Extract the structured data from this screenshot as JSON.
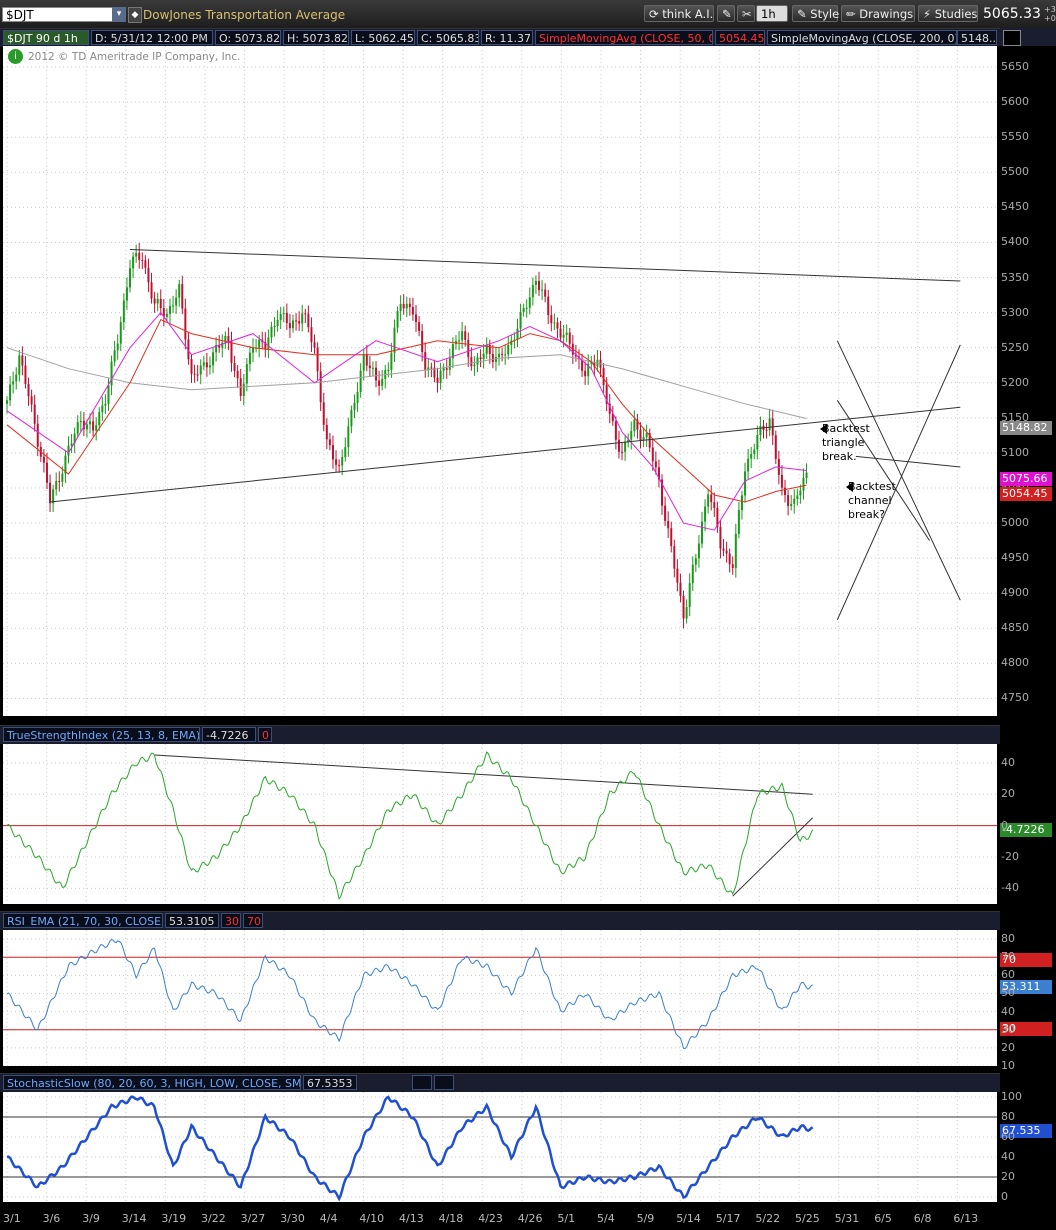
{
  "toolbar": {
    "symbol": "$DJT",
    "description": "DowJones Transportation Average",
    "think_ai": "think A.I.",
    "interval": "1h",
    "style": "Style",
    "drawings": "Drawings",
    "studies": "Studies",
    "last_price": "5065.33",
    "up_down": [
      "+3",
      "+0"
    ]
  },
  "infobar": {
    "symbol_period": "$DJT 90 d 1h",
    "date": "D: 5/31/12 12:00 PM",
    "open": "O: 5073.82",
    "high": "H: 5073.82",
    "low": "L: 5062.45",
    "close": "C: 5065.83",
    "range": "R: 11.37",
    "sma50_label": "SimpleMovingAvg (CLOSE, 50, 0)",
    "sma50_value": "5054.45",
    "sma200_label": "SimpleMovingAvg (CLOSE, 200, 0)",
    "sma200_value": "5148...",
    "copyright": "2012 © TD Ameritrade IP Company, Inc."
  },
  "annotations": {
    "triangle": "Backtest\ntriangle\nbreak.",
    "channel": "Backtest\nchannel\nbreak?"
  },
  "price_tags": {
    "sma200": "5148.82",
    "last": "5075.66",
    "sma50": "5054.45"
  },
  "studies": {
    "tsi_label": "TrueStrengthIndex (25, 13, 8, EMA)",
    "tsi_value": "-4.7226",
    "tsi_zero": "0",
    "tsi_tag": "-4.7226",
    "rsi_label": "RSI_EMA (21, 70, 30, CLOSE)",
    "rsi_value": "53.3105",
    "rsi_os": "30",
    "rsi_ob": "70",
    "rsi_tag": "53.311",
    "rsi_tag_70": "70",
    "rsi_tag_30": "30",
    "stoch_label": "StochasticSlow (80, 20, 60, 3, HIGH, LOW, CLOSE, SMA)",
    "stoch_value": "67.5353",
    "stoch_tag": "67.535"
  },
  "colors": {
    "sma50": "#e03020",
    "sma20": "#e020e0",
    "sma200": "#a0a0a0",
    "up_candle": "#1a9a1a",
    "down_candle": "#c01030",
    "tsi": "#28a828",
    "rsi": "#3a7fd0",
    "stoch": "#2050d0"
  },
  "chart_data": [
    {
      "type": "candlestick",
      "name": "price",
      "x_ticks": [
        "3/1",
        "3/6",
        "3/9",
        "3/14",
        "3/19",
        "3/22",
        "3/27",
        "3/30",
        "4/4",
        "4/10",
        "4/13",
        "4/18",
        "4/23",
        "4/26",
        "5/1",
        "5/4",
        "5/9",
        "5/14",
        "5/17",
        "5/22",
        "5/25",
        "5/31",
        "6/5",
        "6/8",
        "6/13"
      ],
      "y_ticks": [
        4750,
        4800,
        4850,
        4900,
        4950,
        5000,
        5050,
        5100,
        5150,
        5200,
        5250,
        5300,
        5350,
        5400,
        5450,
        5500,
        5550,
        5600,
        5650
      ],
      "ylim": [
        4725,
        5680
      ],
      "close_path": [
        [
          0,
          5170
        ],
        [
          4,
          5240
        ],
        [
          8,
          5160
        ],
        [
          12,
          5080
        ],
        [
          14,
          5030
        ],
        [
          18,
          5080
        ],
        [
          24,
          5150
        ],
        [
          28,
          5130
        ],
        [
          32,
          5180
        ],
        [
          36,
          5260
        ],
        [
          40,
          5370
        ],
        [
          44,
          5380
        ],
        [
          48,
          5310
        ],
        [
          52,
          5300
        ],
        [
          56,
          5330
        ],
        [
          60,
          5210
        ],
        [
          64,
          5220
        ],
        [
          68,
          5250
        ],
        [
          72,
          5260
        ],
        [
          76,
          5180
        ],
        [
          80,
          5260
        ],
        [
          84,
          5250
        ],
        [
          88,
          5300
        ],
        [
          92,
          5280
        ],
        [
          96,
          5300
        ],
        [
          100,
          5250
        ],
        [
          104,
          5110
        ],
        [
          108,
          5080
        ],
        [
          112,
          5150
        ],
        [
          116,
          5240
        ],
        [
          120,
          5200
        ],
        [
          124,
          5220
        ],
        [
          128,
          5320
        ],
        [
          132,
          5300
        ],
        [
          136,
          5230
        ],
        [
          140,
          5200
        ],
        [
          144,
          5240
        ],
        [
          148,
          5270
        ],
        [
          152,
          5220
        ],
        [
          156,
          5250
        ],
        [
          160,
          5230
        ],
        [
          164,
          5260
        ],
        [
          168,
          5300
        ],
        [
          172,
          5350
        ],
        [
          176,
          5300
        ],
        [
          180,
          5270
        ],
        [
          184,
          5250
        ],
        [
          188,
          5210
        ],
        [
          192,
          5240
        ],
        [
          196,
          5150
        ],
        [
          200,
          5100
        ],
        [
          204,
          5140
        ],
        [
          208,
          5120
        ],
        [
          212,
          5060
        ],
        [
          216,
          4960
        ],
        [
          220,
          4870
        ],
        [
          224,
          4950
        ],
        [
          228,
          5050
        ],
        [
          232,
          4970
        ],
        [
          236,
          4940
        ],
        [
          240,
          5080
        ],
        [
          244,
          5120
        ],
        [
          248,
          5150
        ],
        [
          252,
          5040
        ],
        [
          256,
          5030
        ],
        [
          260,
          5066
        ]
      ],
      "sma50_path": [
        [
          0,
          5140
        ],
        [
          20,
          5070
        ],
        [
          40,
          5200
        ],
        [
          50,
          5290
        ],
        [
          60,
          5270
        ],
        [
          80,
          5250
        ],
        [
          100,
          5240
        ],
        [
          120,
          5240
        ],
        [
          140,
          5260
        ],
        [
          160,
          5250
        ],
        [
          170,
          5270
        ],
        [
          180,
          5260
        ],
        [
          190,
          5230
        ],
        [
          200,
          5170
        ],
        [
          210,
          5120
        ],
        [
          220,
          5080
        ],
        [
          230,
          5040
        ],
        [
          240,
          5030
        ],
        [
          250,
          5045
        ],
        [
          260,
          5054
        ]
      ],
      "sma20_path": [
        [
          0,
          5160
        ],
        [
          20,
          5100
        ],
        [
          40,
          5250
        ],
        [
          50,
          5300
        ],
        [
          60,
          5240
        ],
        [
          80,
          5270
        ],
        [
          100,
          5200
        ],
        [
          120,
          5260
        ],
        [
          140,
          5230
        ],
        [
          160,
          5260
        ],
        [
          170,
          5280
        ],
        [
          180,
          5260
        ],
        [
          190,
          5220
        ],
        [
          200,
          5130
        ],
        [
          210,
          5080
        ],
        [
          220,
          5000
        ],
        [
          230,
          4990
        ],
        [
          240,
          5060
        ],
        [
          250,
          5080
        ],
        [
          260,
          5075
        ]
      ],
      "sma200_path": [
        [
          0,
          5250
        ],
        [
          20,
          5220
        ],
        [
          40,
          5200
        ],
        [
          60,
          5190
        ],
        [
          80,
          5195
        ],
        [
          100,
          5200
        ],
        [
          120,
          5210
        ],
        [
          140,
          5220
        ],
        [
          160,
          5235
        ],
        [
          180,
          5240
        ],
        [
          200,
          5220
        ],
        [
          220,
          5195
        ],
        [
          240,
          5170
        ],
        [
          260,
          5149
        ]
      ],
      "trendlines": [
        {
          "from": [
            14,
            5030
          ],
          "to": [
            310,
            5165
          ]
        },
        {
          "from": [
            40,
            5390
          ],
          "to": [
            310,
            5345
          ]
        },
        {
          "from": [
            270,
            4862
          ],
          "to": [
            310,
            5254
          ]
        },
        {
          "from": [
            270,
            5260
          ],
          "to": [
            310,
            4890
          ]
        },
        {
          "from": [
            270,
            5175
          ],
          "to": [
            300,
            4975
          ]
        },
        {
          "from": [
            276,
            5095
          ],
          "to": [
            310,
            5080
          ]
        }
      ]
    },
    {
      "type": "line",
      "name": "TrueStrengthIndex",
      "ylim": [
        -50,
        52
      ],
      "y_ticks": [
        -40,
        -20,
        0,
        20,
        40
      ],
      "zero_line": 0,
      "values": [
        [
          0,
          0
        ],
        [
          10,
          -20
        ],
        [
          18,
          -40
        ],
        [
          26,
          -10
        ],
        [
          34,
          20
        ],
        [
          42,
          40
        ],
        [
          48,
          45
        ],
        [
          54,
          10
        ],
        [
          60,
          -30
        ],
        [
          68,
          -20
        ],
        [
          76,
          0
        ],
        [
          84,
          30
        ],
        [
          92,
          20
        ],
        [
          100,
          0
        ],
        [
          108,
          -45
        ],
        [
          116,
          -20
        ],
        [
          124,
          10
        ],
        [
          132,
          20
        ],
        [
          140,
          0
        ],
        [
          148,
          20
        ],
        [
          156,
          45
        ],
        [
          164,
          30
        ],
        [
          172,
          0
        ],
        [
          180,
          -30
        ],
        [
          188,
          -20
        ],
        [
          196,
          20
        ],
        [
          204,
          35
        ],
        [
          212,
          0
        ],
        [
          220,
          -30
        ],
        [
          228,
          -25
        ],
        [
          236,
          -45
        ],
        [
          244,
          20
        ],
        [
          252,
          25
        ],
        [
          258,
          -10
        ],
        [
          262,
          -4.72
        ]
      ],
      "trendlines": [
        {
          "from": [
            48,
            45
          ],
          "to": [
            262,
            20
          ]
        },
        {
          "from": [
            236,
            -45
          ],
          "to": [
            262,
            5
          ]
        }
      ]
    },
    {
      "type": "line",
      "name": "RSI_EMA",
      "ylim": [
        10,
        85
      ],
      "y_ticks": [
        10,
        20,
        30,
        40,
        50,
        60,
        70,
        80
      ],
      "overbought": 70,
      "oversold": 30,
      "values": [
        [
          0,
          50
        ],
        [
          10,
          30
        ],
        [
          20,
          65
        ],
        [
          30,
          75
        ],
        [
          36,
          80
        ],
        [
          42,
          60
        ],
        [
          48,
          75
        ],
        [
          54,
          40
        ],
        [
          60,
          55
        ],
        [
          68,
          50
        ],
        [
          76,
          35
        ],
        [
          84,
          70
        ],
        [
          92,
          60
        ],
        [
          100,
          35
        ],
        [
          108,
          25
        ],
        [
          116,
          60
        ],
        [
          124,
          65
        ],
        [
          132,
          55
        ],
        [
          140,
          40
        ],
        [
          148,
          70
        ],
        [
          156,
          65
        ],
        [
          164,
          50
        ],
        [
          172,
          75
        ],
        [
          180,
          40
        ],
        [
          188,
          50
        ],
        [
          196,
          35
        ],
        [
          204,
          45
        ],
        [
          212,
          50
        ],
        [
          220,
          20
        ],
        [
          228,
          35
        ],
        [
          236,
          60
        ],
        [
          244,
          65
        ],
        [
          252,
          40
        ],
        [
          258,
          55
        ],
        [
          262,
          53.31
        ]
      ]
    },
    {
      "type": "line",
      "name": "StochasticSlow",
      "ylim": [
        -5,
        105
      ],
      "y_ticks": [
        0,
        20,
        40,
        60,
        80,
        100
      ],
      "levels": [
        80,
        20
      ],
      "values": [
        [
          0,
          40
        ],
        [
          10,
          10
        ],
        [
          18,
          30
        ],
        [
          26,
          60
        ],
        [
          34,
          90
        ],
        [
          42,
          100
        ],
        [
          48,
          90
        ],
        [
          54,
          30
        ],
        [
          60,
          70
        ],
        [
          68,
          40
        ],
        [
          76,
          10
        ],
        [
          84,
          80
        ],
        [
          92,
          60
        ],
        [
          100,
          20
        ],
        [
          108,
          0
        ],
        [
          116,
          60
        ],
        [
          124,
          100
        ],
        [
          132,
          80
        ],
        [
          140,
          30
        ],
        [
          148,
          70
        ],
        [
          156,
          90
        ],
        [
          164,
          40
        ],
        [
          172,
          90
        ],
        [
          180,
          10
        ],
        [
          188,
          20
        ],
        [
          196,
          15
        ],
        [
          204,
          20
        ],
        [
          212,
          30
        ],
        [
          220,
          0
        ],
        [
          228,
          30
        ],
        [
          236,
          60
        ],
        [
          244,
          80
        ],
        [
          252,
          60
        ],
        [
          258,
          70
        ],
        [
          262,
          67.5
        ]
      ]
    }
  ]
}
